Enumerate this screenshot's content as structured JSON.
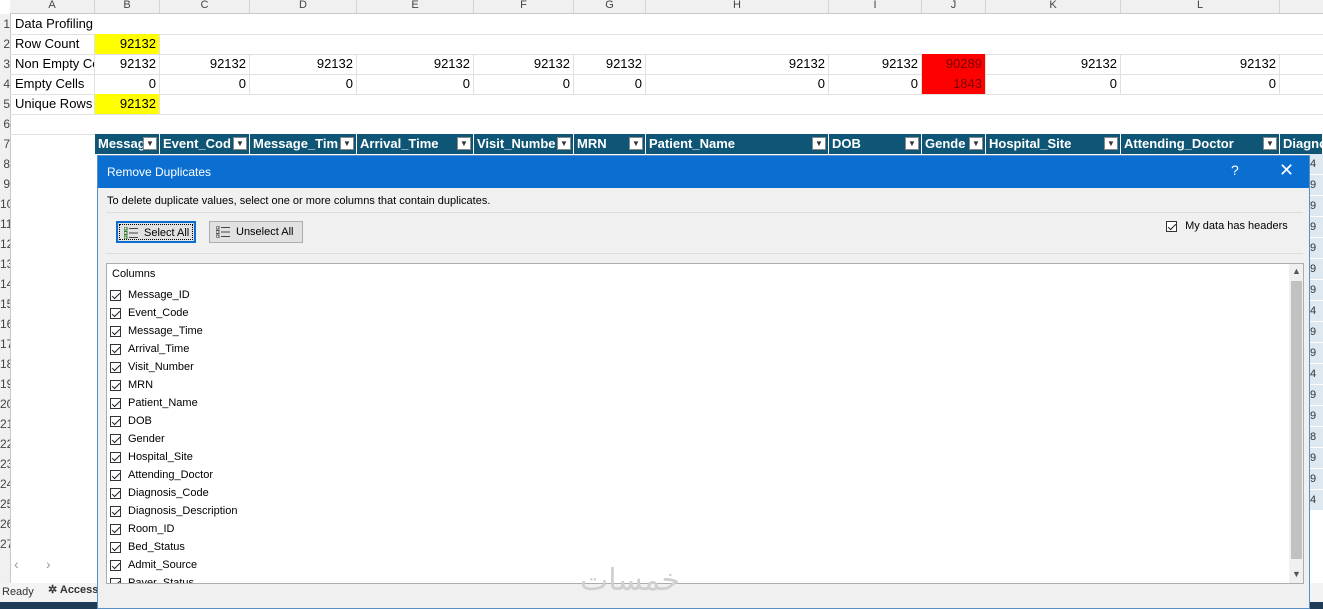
{
  "column_letters": [
    "A",
    "B",
    "C",
    "D",
    "E",
    "F",
    "G",
    "H",
    "I",
    "J",
    "K",
    "L"
  ],
  "row_numbers": [
    "1",
    "2",
    "3",
    "4",
    "5",
    "6",
    "7",
    "8",
    "9",
    "10",
    "11",
    "12",
    "13",
    "14",
    "15",
    "16",
    "17",
    "18",
    "19",
    "20",
    "21",
    "22",
    "23",
    "24",
    "25",
    "26",
    "27"
  ],
  "profiling": {
    "title": "Data Profiling",
    "row_count_label": "Row Count",
    "row_count_value": "92132",
    "non_empty_label": "Non Empty Ce",
    "non_empty_values": [
      "92132",
      "92132",
      "92132",
      "92132",
      "92132",
      "92132",
      "92132",
      "92132",
      "90289",
      "92132",
      "92132"
    ],
    "empty_label": "Empty Cells",
    "empty_values": [
      "0",
      "0",
      "0",
      "0",
      "0",
      "0",
      "0",
      "0",
      "1843",
      "0",
      "0"
    ],
    "unique_label": "Unique Rows",
    "unique_value": "92132"
  },
  "table_headers": [
    "Messag",
    "Event_Cod",
    "Message_Tim",
    "Arrival_Time",
    "Visit_Numbe",
    "MRN",
    "Patient_Name",
    "DOB",
    "Gende",
    "Hospital_Site",
    "Attending_Doctor",
    "Diagno"
  ],
  "right_cells": [
    "4",
    "9",
    "9",
    "9",
    "9",
    "9",
    "9",
    "4",
    "9",
    "9",
    "4",
    "9",
    "9",
    "8",
    "9",
    "9",
    "4"
  ],
  "dialog": {
    "title": "Remove Duplicates",
    "help": "?",
    "close": "✕",
    "instruction": "To delete duplicate values, select one or more columns that contain duplicates.",
    "select_all": "Select All",
    "unselect_all": "Unselect All",
    "headers_checkbox": "My data has headers",
    "columns_label": "Columns",
    "columns": [
      "Message_ID",
      "Event_Code",
      "Message_Time",
      "Arrival_Time",
      "Visit_Number",
      "MRN",
      "Patient_Name",
      "DOB",
      "Gender",
      "Hospital_Site",
      "Attending_Doctor",
      "Diagnosis_Code",
      "Diagnosis_Description",
      "Room_ID",
      "Bed_Status",
      "Admit_Source",
      "Payer_Status"
    ]
  },
  "status": {
    "ready": "Ready",
    "accessibility": "Access"
  },
  "watermark": "خمسات"
}
